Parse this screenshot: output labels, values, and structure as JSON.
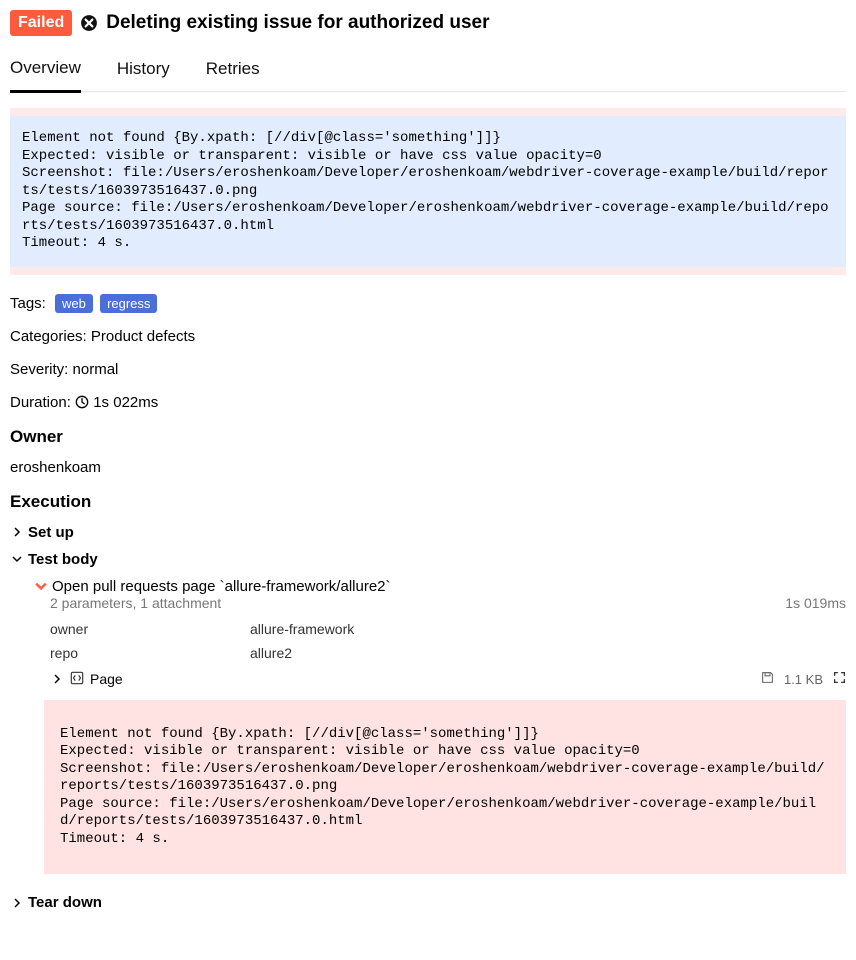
{
  "status": "Failed",
  "title": "Deleting existing issue for authorized user",
  "tabs": {
    "overview": "Overview",
    "history": "History",
    "retries": "Retries"
  },
  "error_text": "Element not found {By.xpath: [//div[@class='something']]}\nExpected: visible or transparent: visible or have css value opacity=0\nScreenshot: file:/Users/eroshenkoam/Developer/eroshenkoam/webdriver-coverage-example/build/reports/tests/1603973516437.0.png\nPage source: file:/Users/eroshenkoam/Developer/eroshenkoam/webdriver-coverage-example/build/reports/tests/1603973516437.0.html\nTimeout: 4 s.",
  "tags_label": "Tags:",
  "tags": {
    "web": "web",
    "regress": "regress"
  },
  "categories_label": "Categories:",
  "categories_value": "Product defects",
  "severity_label": "Severity:",
  "severity_value": "normal",
  "duration_label": "Duration:",
  "duration_value": "1s 022ms",
  "owner_heading": "Owner",
  "owner_value": "eroshenkoam",
  "execution_heading": "Execution",
  "setup_label": "Set up",
  "testbody_label": "Test body",
  "teardown_label": "Tear down",
  "step": {
    "name": "Open pull requests page `allure-framework/allure2`",
    "sub": "2 parameters, 1 attachment",
    "time": "1s 019ms",
    "params": {
      "owner_k": "owner",
      "owner_v": "allure-framework",
      "repo_k": "repo",
      "repo_v": "allure2"
    },
    "attach_name": "Page",
    "attach_size": "1.1 KB"
  }
}
